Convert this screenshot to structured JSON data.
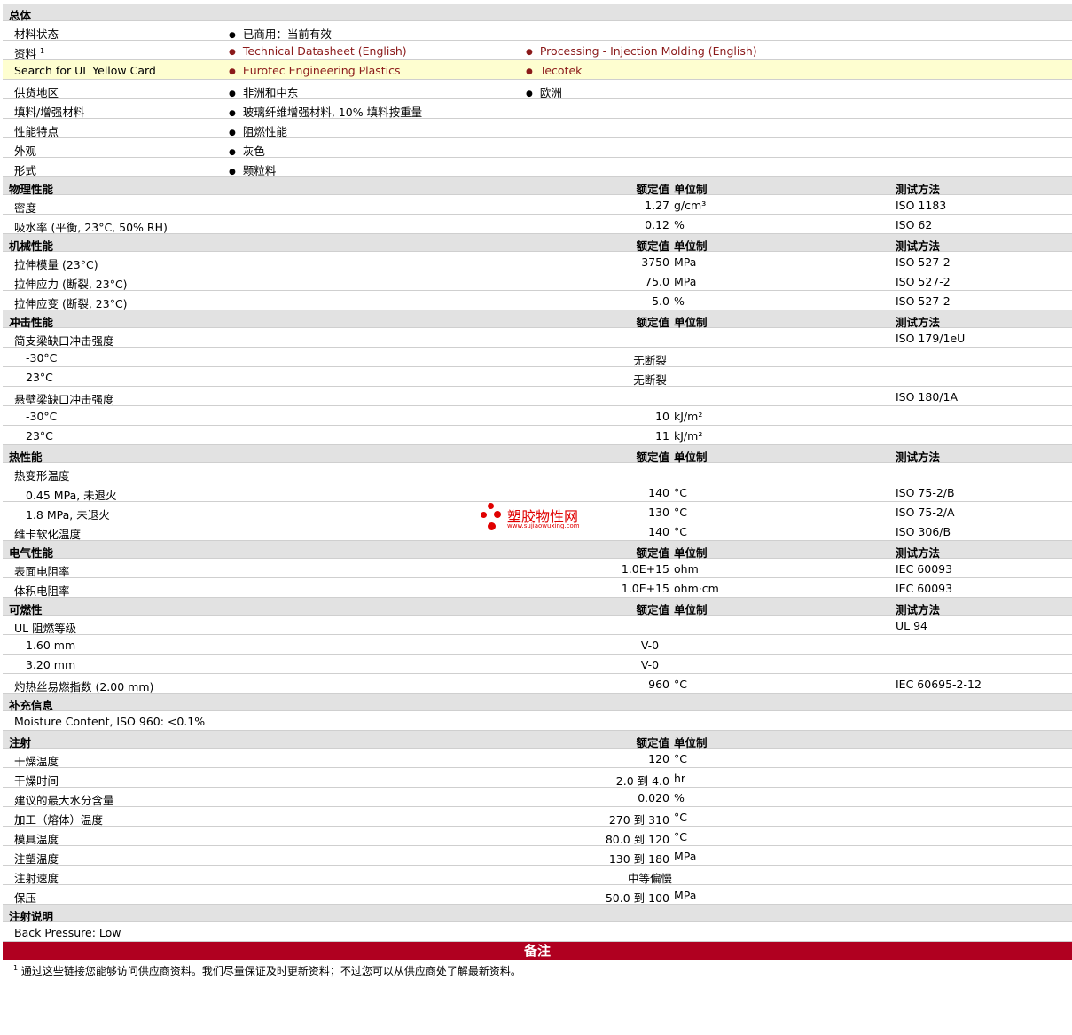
{
  "sections": {
    "general": "总体",
    "physical": "物理性能",
    "mechanical": "机械性能",
    "impact": "冲击性能",
    "thermal": "热性能",
    "electrical": "电气性能",
    "flammability": "可燃性",
    "additional": "补充信息",
    "injection": "注射",
    "injection_notes": "注射说明"
  },
  "headers": {
    "nominal": "额定值",
    "unit": "单位制",
    "method": "测试方法"
  },
  "general": {
    "material_status_label": "材料状态",
    "material_status_value": "已商用：当前有效",
    "docs_label": "资料",
    "docs_sup": "1",
    "doc1": "Technical Datasheet (English)",
    "doc2": "Processing - Injection Molding (English)",
    "ul_label": "Search for UL Yellow Card",
    "ul1": "Eurotec Engineering Plastics",
    "ul2": "Tecotek",
    "region_label": "供货地区",
    "region1": "非洲和中东",
    "region2": "欧洲",
    "filler_label": "填料/增强材料",
    "filler_value": "玻璃纤维增强材料, 10% 填料按重量",
    "features_label": "性能特点",
    "features_value": "阻燃性能",
    "appearance_label": "外观",
    "appearance_value": "灰色",
    "form_label": "形式",
    "form_value": "颗粒料"
  },
  "physical": [
    {
      "label": "密度",
      "value": "1.27",
      "unit": "g/cm³",
      "method": "ISO 1183"
    },
    {
      "label": "吸水率 (平衡, 23°C, 50% RH)",
      "value": "0.12",
      "unit": "%",
      "method": "ISO 62"
    }
  ],
  "mechanical": [
    {
      "label": "拉伸模量 (23°C)",
      "value": "3750",
      "unit": "MPa",
      "method": "ISO 527-2"
    },
    {
      "label": "拉伸应力 (断裂, 23°C)",
      "value": "75.0",
      "unit": "MPa",
      "method": "ISO 527-2"
    },
    {
      "label": "拉伸应变 (断裂, 23°C)",
      "value": "5.0",
      "unit": "%",
      "method": "ISO 527-2"
    }
  ],
  "impact": {
    "charpy_label": "简支梁缺口冲击强度",
    "charpy_method": "ISO 179/1eU",
    "charpy_rows": [
      {
        "label": "-30°C",
        "value": "无断裂"
      },
      {
        "label": "23°C",
        "value": "无断裂"
      }
    ],
    "izod_label": "悬壁梁缺口冲击强度",
    "izod_method": "ISO 180/1A",
    "izod_rows": [
      {
        "label": "-30°C",
        "value": "10",
        "unit": "kJ/m²"
      },
      {
        "label": "23°C",
        "value": "11",
        "unit": "kJ/m²"
      }
    ]
  },
  "thermal": {
    "hdt_label": "热变形温度",
    "hdt_rows": [
      {
        "label": "0.45 MPa, 未退火",
        "value": "140",
        "unit": "°C",
        "method": "ISO 75-2/B"
      },
      {
        "label": "1.8 MPa, 未退火",
        "value": "130",
        "unit": "°C",
        "method": "ISO 75-2/A"
      }
    ],
    "vicat": {
      "label": "维卡软化温度",
      "value": "140",
      "unit": "°C",
      "method": "ISO 306/B"
    }
  },
  "electrical": [
    {
      "label": "表面电阻率",
      "value": "1.0E+15",
      "unit": "ohm",
      "method": "IEC 60093"
    },
    {
      "label": "体积电阻率",
      "value": "1.0E+15",
      "unit": "ohm·cm",
      "method": "IEC 60093"
    }
  ],
  "flammability": {
    "ul_label": "UL 阻燃等级",
    "ul_method": "UL 94",
    "ul_rows": [
      {
        "label": "1.60 mm",
        "value": "V-0"
      },
      {
        "label": "3.20 mm",
        "value": "V-0"
      }
    ],
    "gwfi": {
      "label": "灼热丝易燃指数 (2.00 mm)",
      "value": "960",
      "unit": "°C",
      "method": "IEC 60695-2-12"
    }
  },
  "additional": {
    "text": "Moisture Content, ISO 960: <0.1%"
  },
  "injection": [
    {
      "label": "干燥温度",
      "value": "120",
      "unit": "°C"
    },
    {
      "label": "干燥时间",
      "value": "2.0 到  4.0",
      "unit": "hr"
    },
    {
      "label": "建议的最大水分含量",
      "value": "0.020",
      "unit": "%"
    },
    {
      "label": "加工（熔体）温度",
      "value": "270 到  310",
      "unit": "°C"
    },
    {
      "label": "模具温度",
      "value": "80.0 到  120",
      "unit": "°C"
    },
    {
      "label": "注塑温度",
      "value": "130 到  180",
      "unit": "MPa"
    },
    {
      "label": "注射速度",
      "value": "中等偏慢",
      "unit": ""
    },
    {
      "label": "保压",
      "value": "50.0 到  100",
      "unit": "MPa"
    }
  ],
  "injection_notes": {
    "text": "Back Pressure: Low"
  },
  "notes": {
    "title": "备注",
    "footnote_sup": "1",
    "footnote": "通过这些链接您能够访问供应商资料。我们尽量保证及时更新资料；不过您可以从供应商处了解最新资料。"
  },
  "watermark": {
    "name": "塑胶物性网",
    "url": "www.sujiaowuxing.com"
  },
  "colors": {
    "section_bg": "#e2e2e2",
    "link": "#8b1a1a",
    "highlight": "#fefed0",
    "note_bar": "#b00020",
    "watermark": "#e00000"
  }
}
